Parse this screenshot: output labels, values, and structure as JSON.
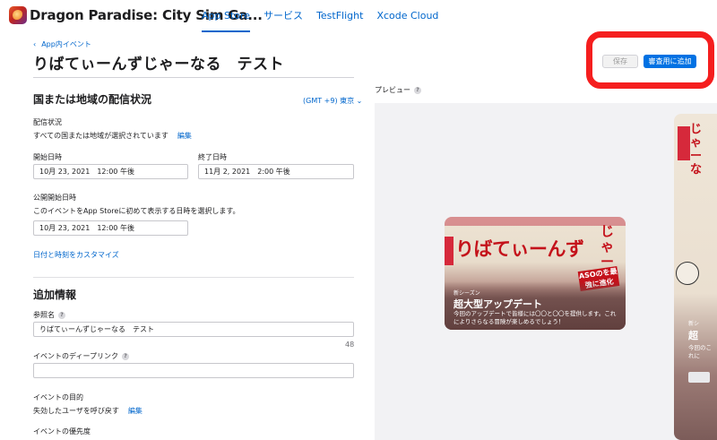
{
  "nav": {
    "app_title": "Dragon Paradise: City Sim Ga...",
    "links": [
      {
        "label": "App Store",
        "active": true
      },
      {
        "label": "サービス",
        "active": false
      },
      {
        "label": "TestFlight",
        "active": false
      },
      {
        "label": "Xcode Cloud",
        "active": false
      }
    ]
  },
  "header": {
    "breadcrumb": "App内イベント",
    "title": "りばてぃーんずじゃーなる　テスト",
    "save_label": "保存",
    "submit_label": "審査用に追加"
  },
  "availability": {
    "title": "国または地域の配信状況",
    "timezone": "(GMT +9) 東京",
    "status_label": "配信状況",
    "status_text": "すべての国または地域が選択されています",
    "edit_label": "編集",
    "start_label": "開始日時",
    "start_value": "10月 23, 2021　12:00 午後",
    "end_label": "終了日時",
    "end_value": "11月 2, 2021　2:00 午後",
    "publish_label": "公開開始日時",
    "publish_help": "このイベントをApp Storeに初めて表示する日時を選択します。",
    "publish_value": "10月 23, 2021　12:00 午後",
    "customize_link": "日付と時刻をカスタマイズ"
  },
  "additional": {
    "title": "追加情報",
    "reference_label": "参照名",
    "reference_value": "りばてぃーんずじゃーなる　テスト",
    "char_count": "48",
    "deeplink_label": "イベントのディープリンク",
    "deeplink_value": "",
    "purpose_label": "イベントの目的",
    "purpose_value": "失効したユーザを呼び戻す",
    "purpose_edit": "編集",
    "priority_label": "イベントの優先度"
  },
  "preview": {
    "label": "プレビュー",
    "card": {
      "art_title": "りばてぃーんず",
      "art_side": "じゃーな",
      "art_badge": "ASOのを最強に進化",
      "kicker": "新シーズン",
      "heading": "超大型アップデート",
      "body": "今回のアップデートで皆様には〇〇と〇〇を提供します。これによりさらなる冒険が楽しめるでしょう！"
    },
    "card2": {
      "art_text": "じゃーな",
      "kicker": "新シ",
      "heading": "超",
      "body": "今回のこれに"
    }
  },
  "colors": {
    "accent": "#0071e3",
    "link": "#0066cc",
    "highlight": "#f51e1e"
  }
}
